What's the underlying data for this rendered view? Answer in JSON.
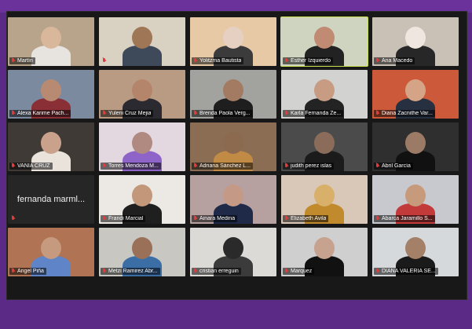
{
  "window": {
    "title": ""
  },
  "participants": [
    {
      "name": "Martín",
      "bg": "#b8a48a",
      "skin": "#d8b79a",
      "shirt": "#e7e4df"
    },
    {
      "name": "",
      "bg": "#d9d2c3",
      "skin": "#9f7656",
      "shirt": "#3e4a5a"
    },
    {
      "name": "Yolitzma Bautista",
      "bg": "#e7c9a6",
      "skin": "#e6d0c2",
      "shirt": "#3b3b3b"
    },
    {
      "name": "Esther Izquierdo",
      "bg": "#cfd4c0",
      "skin": "#c08b72",
      "shirt": "#222222",
      "active": true
    },
    {
      "name": "Ana Macedo",
      "bg": "#c9c0b6",
      "skin": "#efe6df",
      "shirt": "#272727"
    },
    {
      "name": "Alexa Karime Pach...",
      "bg": "#7c8aa0",
      "skin": "#b98a72",
      "shirt": "#8a2f36"
    },
    {
      "name": "Yuleni Cruz Mejia",
      "bg": "#b99a82",
      "skin": "#b4856a",
      "shirt": "#2a2a30"
    },
    {
      "name": "Brenda Paola Verg...",
      "bg": "#a2a39e",
      "skin": "#a37a62",
      "shirt": "#1e1e1e"
    },
    {
      "name": "Karla Fernanda Ze...",
      "bg": "#d2d2d0",
      "skin": "#c89b83",
      "shirt": "#232323"
    },
    {
      "name": "Diana Zacnithe Var...",
      "bg": "#cc5a3a",
      "skin": "#d5a487",
      "shirt": "#263040"
    },
    {
      "name": "VANIA CRUZ",
      "bg": "#3f3a36",
      "skin": "#caa28b",
      "shirt": "#e9e3dc"
    },
    {
      "name": "Torres Mendoza M...",
      "bg": "#e3d8df",
      "skin": "#b08a80",
      "shirt": "#8f64c8"
    },
    {
      "name": "Adriana Sánchez L...",
      "bg": "#8a6d52",
      "skin": "#8b6a50",
      "shirt": "#c28b45"
    },
    {
      "name": "judith perez islas",
      "bg": "#4b4b4b",
      "skin": "#8b6c5a",
      "shirt": "#1b1b1b"
    },
    {
      "name": "Abril García",
      "bg": "#2f2f2f",
      "skin": "#9c7b66",
      "shirt": "#111111"
    },
    {
      "name": "fernanda marml...",
      "text_only": true
    },
    {
      "name": "Frandi Marcial",
      "bg": "#ece9e4",
      "skin": "#c2977a",
      "shirt": "#1f1f1f"
    },
    {
      "name": "Ainara Medina",
      "bg": "#b7a0a0",
      "skin": "#c49a86",
      "shirt": "#1e2a48"
    },
    {
      "name": "Elizabeth Avila",
      "bg": "#d9c7b7",
      "skin": "#d9b06a",
      "shirt": "#c08a2d"
    },
    {
      "name": "Abarca Jaramillo S...",
      "bg": "#c8c9cf",
      "skin": "#c79a7c",
      "shirt": "#c23a3a"
    },
    {
      "name": "Angel Piña",
      "bg": "#b07454",
      "skin": "#c69a7e",
      "shirt": "#5f84c8"
    },
    {
      "name": "Metzi Ramirez Abr...",
      "bg": "#c9c7c1",
      "skin": "#9a7058",
      "shirt": "#3c6ea6"
    },
    {
      "name": "cristian erreguin",
      "bg": "#dcdad6",
      "skin": "#2a2a2a",
      "shirt": "#3b3b3b"
    },
    {
      "name": "Marquez",
      "bg": "#cfcfcf",
      "skin": "#c6a28f",
      "shirt": "#111111"
    },
    {
      "name": "DIANA VALERIA SE...",
      "bg": "#d6d9dc",
      "skin": "#a58068",
      "shirt": "#1a1a1a"
    }
  ]
}
